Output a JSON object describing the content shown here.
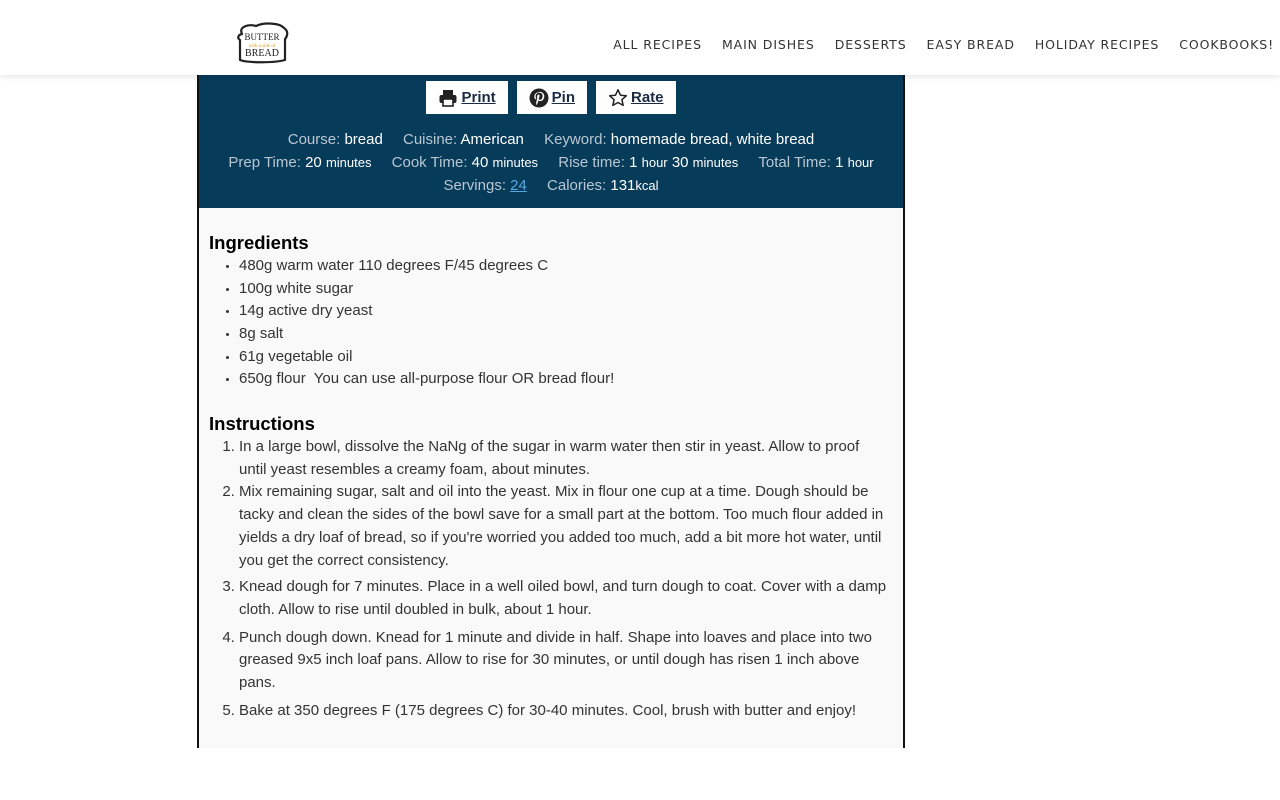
{
  "header": {
    "logo": {
      "line1": "BUTTER",
      "line2": "with a side of",
      "line3": "BREAD",
      "accent_color": "#d4a72c"
    },
    "nav": [
      {
        "label": "ALL RECIPES"
      },
      {
        "label": "MAIN DISHES"
      },
      {
        "label": "DESSERTS"
      },
      {
        "label": "EASY BREAD"
      },
      {
        "label": "HOLIDAY RECIPES"
      },
      {
        "label": "COOKBOOKS!"
      }
    ]
  },
  "recipe": {
    "theme_color": "#073b5a",
    "buttons": [
      {
        "label": "Print",
        "icon": "printer-icon"
      },
      {
        "label": "Pin",
        "icon": "pinterest-icon"
      },
      {
        "label": "Rate",
        "icon": "star-icon"
      }
    ],
    "meta": {
      "course_label": "Course:",
      "course": "bread",
      "cuisine_label": "Cuisine:",
      "cuisine": "American",
      "keyword_label": "Keyword:",
      "keyword": "homemade bread, white bread",
      "prep_label": "Prep Time:",
      "prep_value": "20",
      "prep_unit": "minutes",
      "cook_label": "Cook Time:",
      "cook_value": "40",
      "cook_unit": "minutes",
      "rise_label": "Rise time:",
      "rise_hours": "1",
      "rise_hours_unit": "hour",
      "rise_minutes": "30",
      "rise_minutes_unit": "minutes",
      "total_label": "Total Time:",
      "total_value": "1",
      "total_unit": "hour",
      "servings_label": "Servings:",
      "servings": "24",
      "calories_label": "Calories:",
      "calories": "131",
      "calories_unit": "kcal"
    },
    "ingredients_title": "Ingredients",
    "ingredients": [
      "480g warm water 110 degrees F/45 degrees C",
      "100g white sugar",
      "14g active dry yeast",
      "8g salt",
      "61g vegetable oil",
      "650g flour  You can use all-purpose flour OR bread flour!"
    ],
    "instructions_title": "Instructions",
    "instructions": [
      "In a large bowl, dissolve the NaNg of the sugar in warm water then stir in yeast. Allow to proof until yeast resembles a creamy foam, about minutes.",
      "Mix remaining sugar, salt and oil into the yeast. Mix in flour one cup at a time. Dough should be tacky and clean the sides of the bowl save for a small part at the bottom. Too much flour added in yields a dry loaf of bread, so if you're worried you added too much, add a bit more hot water, until you get the correct consistency.",
      "Knead dough for 7 minutes. Place in a well oiled bowl, and turn dough to coat. Cover with a damp cloth. Allow to rise until doubled in bulk, about 1 hour.",
      "Punch dough down. Knead for 1 minute and divide in half. Shape into loaves and place into two greased 9x5 inch loaf pans. Allow to rise for 30 minutes, or until dough has risen 1 inch above pans.",
      "Bake at 350 degrees F (175 degrees C) for 30-40 minutes. Cool, brush with butter and enjoy!"
    ]
  }
}
